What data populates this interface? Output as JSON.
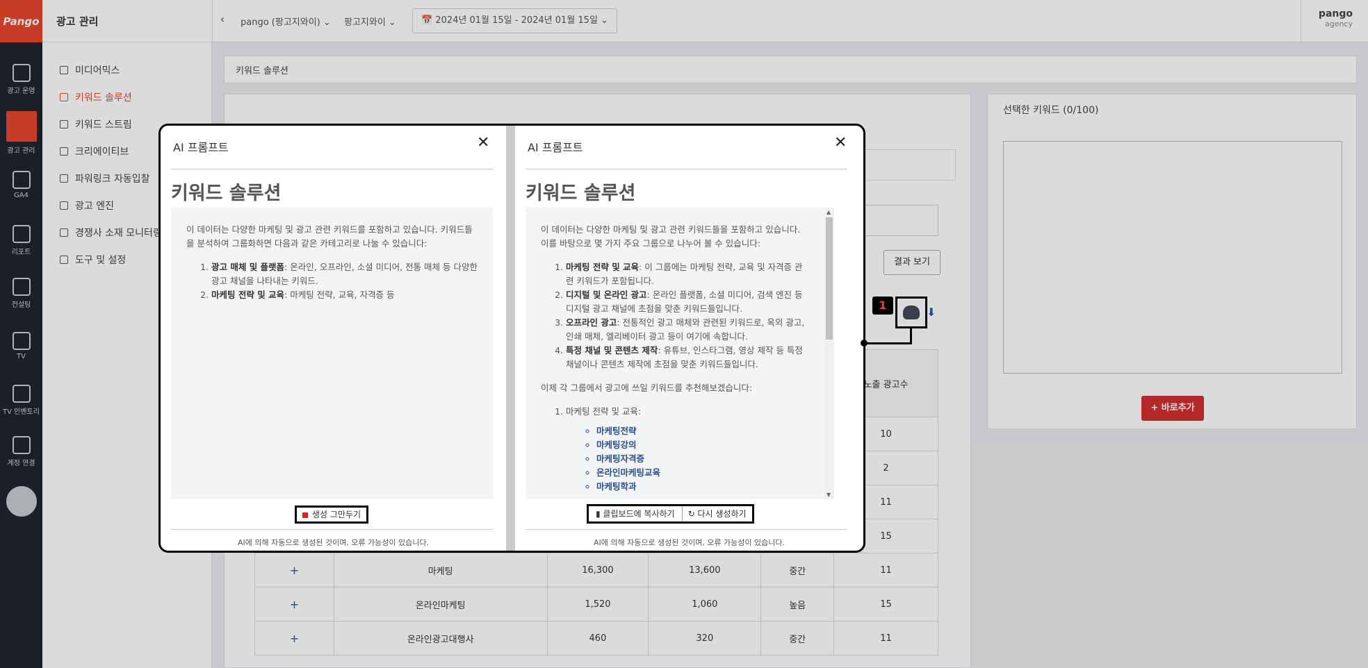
{
  "rail": {
    "logo": "Pango",
    "items": [
      {
        "label": "광고 운영",
        "icon": "ad-icon"
      },
      {
        "label": "광고 관리",
        "icon": "gear-icon"
      },
      {
        "label": "GA4",
        "icon": "chart-icon"
      },
      {
        "label": "리포트",
        "icon": "report-icon"
      },
      {
        "label": "컨설팅",
        "icon": "consulting-icon"
      },
      {
        "label": "TV",
        "icon": "tv-icon"
      },
      {
        "label": "TV 인벤토리",
        "icon": "cart-icon"
      },
      {
        "label": "계정 연결",
        "icon": "link-icon"
      }
    ]
  },
  "topbar": {
    "title": "광고 관리",
    "account": "pango (팡고지와이) ⌄",
    "brand": "팡고지와이 ⌄",
    "date_range": "📅 2024년 01월 15일 - 2024년 01월 15일 ⌄",
    "user_name": "pango",
    "user_role": "agency"
  },
  "subnav": {
    "items": [
      {
        "label": "미디어믹스"
      },
      {
        "label": "키워드 솔루션"
      },
      {
        "label": "키워드 스트림"
      },
      {
        "label": "크리에이티브"
      },
      {
        "label": "파워링크 자동입찰"
      },
      {
        "label": "광고 엔진"
      },
      {
        "label": "경쟁사 소재 모니터링"
      },
      {
        "label": "도구 및 설정"
      }
    ]
  },
  "breadcrumb": "키워드 솔루션",
  "selected": {
    "title": "선택한 키워드 (0/100)",
    "add_now": "+ 바로추가"
  },
  "result_btn": "결과 보기",
  "table": {
    "header_ads_count": "노출 광고수",
    "rows": [
      {
        "keyword": "",
        "v1": "",
        "v2": "",
        "comp": "",
        "ads": "10"
      },
      {
        "keyword": "",
        "v1": "",
        "v2": "",
        "comp": "",
        "ads": "2"
      },
      {
        "keyword": "",
        "v1": "",
        "v2": "",
        "comp": "",
        "ads": "11"
      },
      {
        "keyword": "",
        "v1": "",
        "v2": "",
        "comp": "",
        "ads": "15"
      },
      {
        "keyword": "마케팅",
        "v1": "16,300",
        "v2": "13,600",
        "comp": "중간",
        "ads": "11"
      },
      {
        "keyword": "온라인마케팅",
        "v1": "1,520",
        "v2": "1,060",
        "comp": "높음",
        "ads": "15"
      },
      {
        "keyword": "온라인광고대행사",
        "v1": "460",
        "v2": "320",
        "comp": "중간",
        "ads": "11"
      }
    ]
  },
  "modal_left": {
    "title": "AI 프롬프트",
    "heading": "키워드 솔루션",
    "intro": "이 데이터는 다양한 마케팅 및 광고 관련 키워드를 포함하고 있습니다. 키워드들을 분석하여 그룹화하면 다음과 같은 카테고리로 나눌 수 있습니다:",
    "item1_bold": "광고 매체 및 플랫폼",
    "item1_text": ": 온라인, 오프라인, 소셜 미디어, 전통 매체 등 다양한 광고 채널을 나타내는 키워드.",
    "item2_bold": "마케팅 전략 및 교육",
    "item2_text": ": 마케팅 전략, 교육, 자격증 등",
    "stop_btn": "생성 그만두기",
    "disclaimer": "AI에 의해 자동으로 생성된 것이며, 오류 가능성이 있습니다."
  },
  "modal_right": {
    "title": "AI 프롬프트",
    "heading": "키워드 솔루션",
    "intro": "이 데이터는 다양한 마케팅 및 광고 관련 키워드들을 포함하고 있습니다. 이를 바탕으로 몇 가지 주요 그룹으로 나누어 볼 수 있습니다:",
    "g1_bold": "마케팅 전략 및 교육",
    "g1_text": ": 이 그룹에는 마케팅 전략, 교육 및 자격증 관련 키워드가 포함됩니다.",
    "g2_bold": "디지털 및 온라인 광고",
    "g2_text": ": 온라인 플랫폼, 소셜 미디어, 검색 엔진 등 디지털 광고 채널에 초점을 맞춘 키워드들입니다.",
    "g3_bold": "오프라인 광고",
    "g3_text": ": 전통적인 광고 매체와 관련된 키워드로, 옥외 광고, 인쇄 매체, 엘리베이터 광고 등이 여기에 속합니다.",
    "g4_bold": "특정 채널 및 콘텐츠 제작",
    "g4_text": ": 유튜브, 인스타그램, 영상 제작 등 특정 채널이나 콘텐츠 제작에 초점을 맞춘 키워드들입니다.",
    "recommend": "이제 각 그룹에서 광고에 쓰일 키워드를 추천해보겠습니다:",
    "rec1": "마케팅 전략 및 교육:",
    "keywords": [
      "마케팅전략",
      "마케팅강의",
      "마케팅자격증",
      "온라인마케팅교육",
      "마케팅학과"
    ],
    "copy_btn": "클립보드에 복사하기",
    "regen_btn": "다시 생성하기",
    "disclaimer": "AI에 의해 자동으로 생성된 것이며, 오류 가능성이 있습니다."
  },
  "annotation": {
    "badge": "1"
  }
}
